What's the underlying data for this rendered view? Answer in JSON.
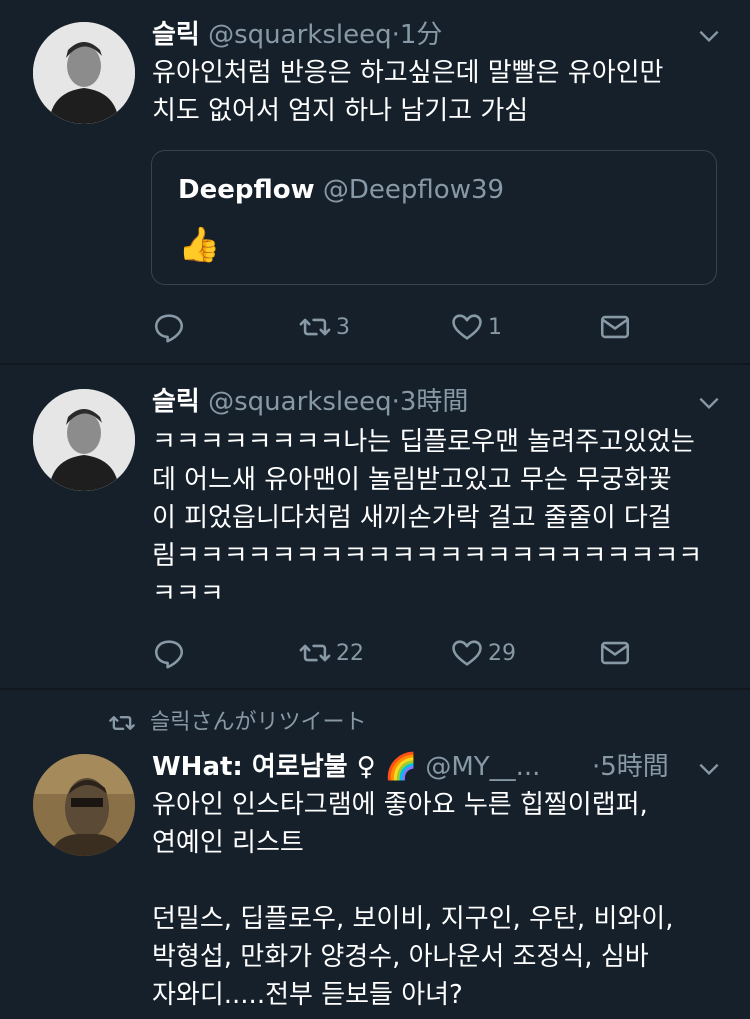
{
  "tweets": [
    {
      "name": "슬릭",
      "handle": "@squarksleeq",
      "dot": "·",
      "time": "1分",
      "text": "유아인처럼 반응은 하고싶은데 말빨은 유아인만\n치도 없어서 엄지 하나 남기고 가심",
      "quote": {
        "name": "Deepflow",
        "handle": "@Deepflow39",
        "text": "👍"
      },
      "retweets": "3",
      "likes": "1"
    },
    {
      "name": "슬릭",
      "handle": "@squarksleeq",
      "dot": "·",
      "time": "3時間",
      "text": "ㅋㅋㅋㅋㅋㅋㅋㅋ나는 딥플로우맨 놀려주고있었는\n데 어느새 유아맨이 놀림받고있고 무슨 무궁화꽃\n이 피었읍니다처럼 새끼손가락 걸고 줄줄이 다걸\n림ㅋㅋㅋㅋㅋㅋㅋㅋㅋㅋㅋㅋㅋㅋㅋㅋㅋㅋㅋㅋㅋㅋ\nㅋㅋㅋ",
      "retweets": "22",
      "likes": "29"
    },
    {
      "retweet_context": "슬릭さんがリツイート",
      "name": "WHat: 여로남불 ♀ 🌈",
      "handle": "@MY__...",
      "dot": "·",
      "time": "5時間",
      "text": "유아인 인스타그램에 좋아요 누른 힙찔이랩퍼,\n연예인 리스트\n\n던밀스, 딥플로우, 보이비, 지구인, 우탄, 비와이,\n박형섭, 만화가 양경수, 아나운서 조정식, 심바\n자와디.....전부 듣보들 아녀?"
    }
  ],
  "icons": {
    "reply": "reply-icon",
    "retweet": "retweet-icon",
    "like": "heart-icon",
    "dm": "envelope-icon",
    "more": "chevron-down-icon"
  },
  "colors": {
    "background": "#15202b",
    "secondary_text": "#8899a6",
    "border": "#38444d"
  }
}
